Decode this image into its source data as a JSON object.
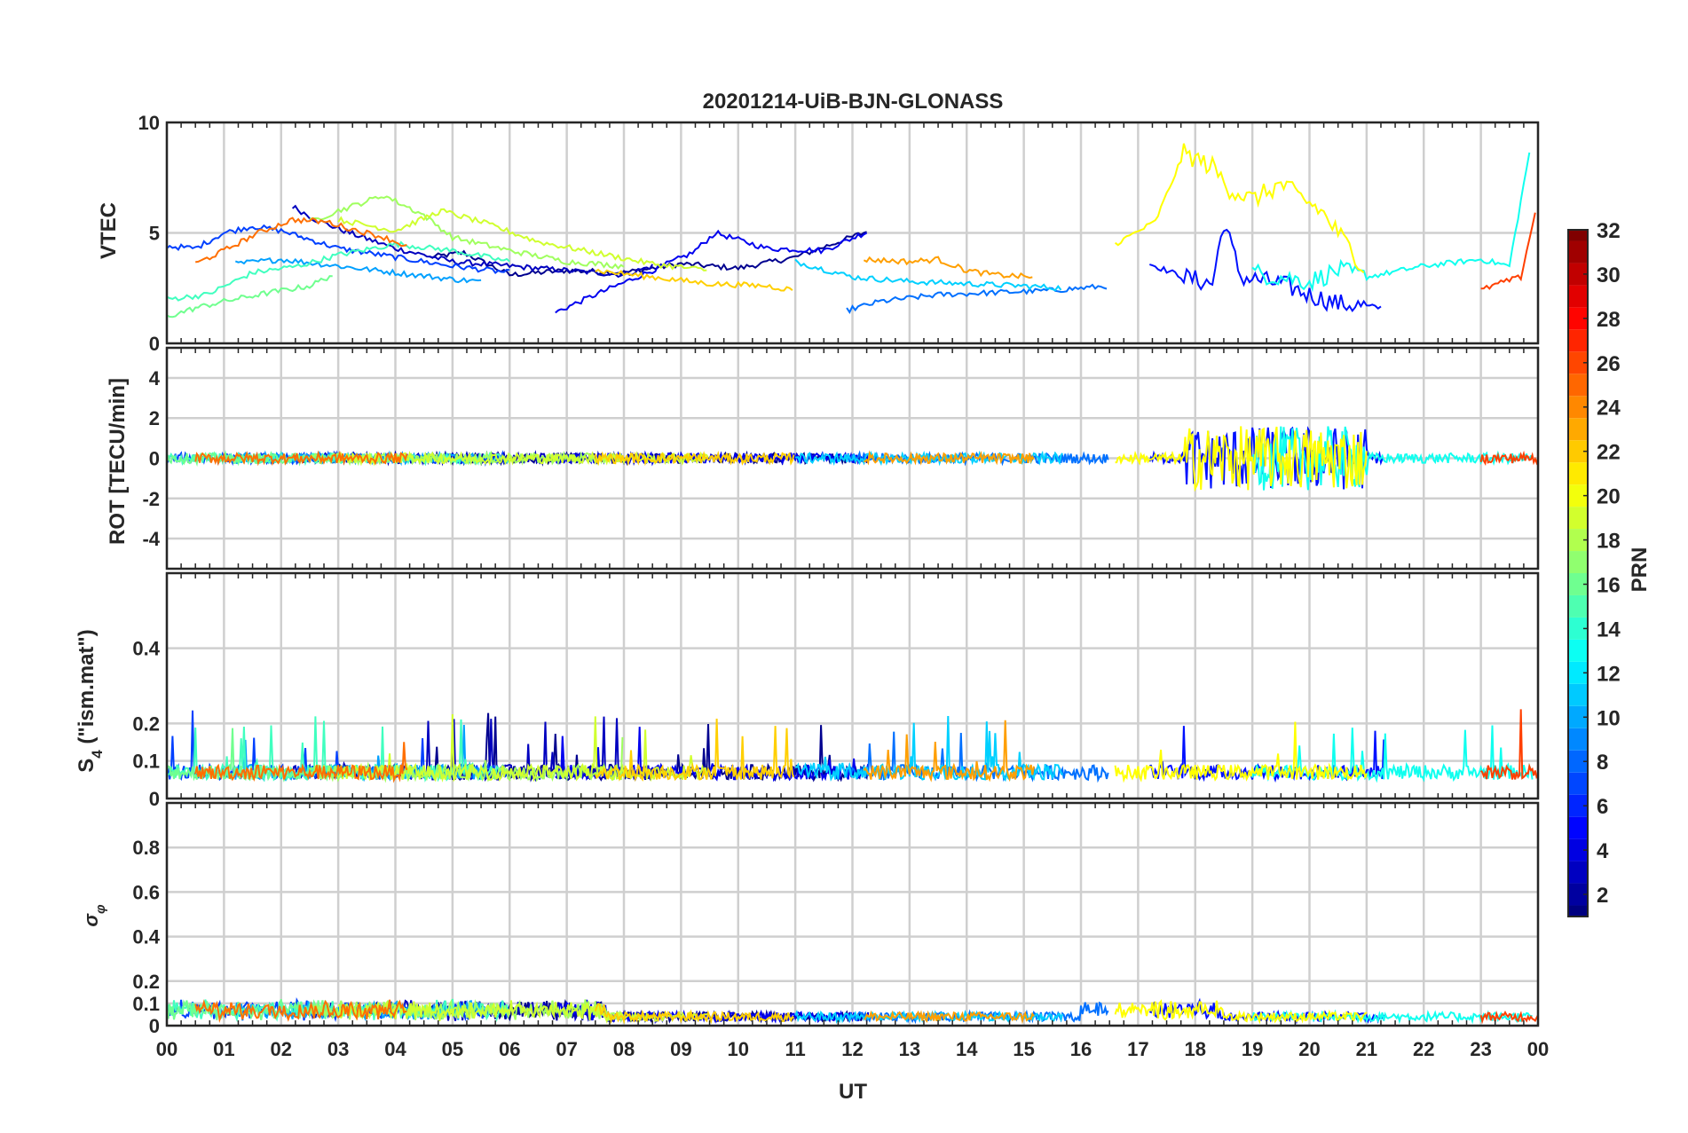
{
  "chart_data": {
    "type": "line",
    "title": "20201214-UiB-BJN-GLONASS",
    "xlabel": "UT",
    "x_tick_labels": [
      "00",
      "01",
      "02",
      "03",
      "04",
      "05",
      "06",
      "07",
      "08",
      "09",
      "10",
      "11",
      "12",
      "13",
      "14",
      "15",
      "16",
      "17",
      "18",
      "19",
      "20",
      "21",
      "22",
      "23",
      "00"
    ],
    "x_range_hours": [
      0,
      24
    ],
    "grid": true,
    "panels": [
      {
        "id": "vtec",
        "ylabel": "VTEC",
        "ylim": [
          0,
          10
        ],
        "y_ticks": [
          0,
          5,
          10
        ],
        "y_tick_labels": [
          "0",
          "5",
          "10"
        ]
      },
      {
        "id": "rot",
        "ylabel": "ROT [TECU/min]",
        "ylim": [
          -5.5,
          5.5
        ],
        "y_ticks": [
          -4,
          -2,
          0,
          2,
          4
        ],
        "y_tick_labels": [
          "-4",
          "-2",
          "0",
          "2",
          "4"
        ]
      },
      {
        "id": "s4",
        "ylabel_main": "S",
        "ylabel_sub": "4",
        "ylabel_rest": " (\"ism.mat\")",
        "ylim": [
          0,
          0.6
        ],
        "y_ticks": [
          0,
          0.1,
          0.2,
          0.4
        ],
        "y_tick_labels": [
          "0",
          "0.1",
          "0.2",
          "0.4"
        ]
      },
      {
        "id": "sigma",
        "ylabel_main": "σ",
        "ylabel_sub": "φ",
        "ylim": [
          0,
          1
        ],
        "y_ticks": [
          0,
          0.1,
          0.2,
          0.4,
          0.6,
          0.8
        ],
        "y_tick_labels": [
          "0",
          "0.1",
          "0.2",
          "0.4",
          "0.6",
          "0.8"
        ]
      }
    ],
    "colorbar": {
      "label": "PRN",
      "range": [
        1,
        32
      ],
      "colormap": "jet",
      "ticks": [
        2,
        4,
        6,
        8,
        10,
        12,
        14,
        16,
        18,
        20,
        22,
        24,
        26,
        28,
        30,
        32
      ],
      "tick_labels": [
        "2",
        "4",
        "6",
        "8",
        "10",
        "12",
        "14",
        "16",
        "18",
        "20",
        "22",
        "24",
        "26",
        "28",
        "30",
        "32"
      ]
    },
    "series": [
      {
        "prn": 1,
        "color": "#00008f",
        "vtec": [
          [
            4.6,
            3.9
          ],
          [
            5.2,
            4.1
          ],
          [
            6.0,
            3.1
          ],
          [
            7.0,
            3.3
          ],
          [
            8.0,
            3.2
          ],
          [
            9.0,
            3.6
          ],
          [
            10.0,
            3.4
          ],
          [
            11.0,
            3.9
          ],
          [
            12.3,
            5.1
          ]
        ]
      },
      {
        "prn": 2,
        "color": "#0000bf",
        "vtec": [
          [
            2.2,
            6.2
          ],
          [
            2.6,
            5.6
          ],
          [
            3.2,
            5.0
          ],
          [
            4.0,
            4.3
          ],
          [
            5.0,
            3.7
          ],
          [
            6.0,
            3.5
          ],
          [
            7.0,
            3.3
          ],
          [
            8.0,
            3.1
          ],
          [
            8.5,
            3.5
          ]
        ]
      },
      {
        "prn": 3,
        "color": "#0000ef",
        "vtec": [
          [
            6.8,
            1.4
          ],
          [
            7.5,
            2.2
          ],
          [
            8.5,
            3.3
          ],
          [
            9.2,
            4.1
          ],
          [
            9.6,
            5.0
          ],
          [
            10.5,
            4.3
          ],
          [
            11.5,
            4.2
          ],
          [
            12.3,
            5.1
          ]
        ]
      },
      {
        "prn": 4,
        "color": "#0010ff",
        "vtec": [
          [
            17.2,
            3.6
          ],
          [
            17.8,
            3.0
          ],
          [
            18.3,
            2.7
          ],
          [
            18.5,
            5.5
          ],
          [
            18.8,
            3.0
          ],
          [
            19.5,
            2.7
          ],
          [
            20.0,
            2.2
          ],
          [
            20.5,
            1.8
          ],
          [
            21.3,
            1.6
          ]
        ]
      },
      {
        "prn": 5,
        "color": "#0040ff",
        "vtec": [
          [
            0.0,
            4.4
          ],
          [
            0.5,
            4.3
          ],
          [
            1.0,
            5.0
          ],
          [
            1.5,
            5.3
          ],
          [
            2.0,
            5.1
          ],
          [
            3.0,
            4.3
          ],
          [
            4.0,
            3.9
          ],
          [
            5.0,
            3.5
          ],
          [
            6.0,
            3.2
          ]
        ]
      },
      {
        "prn": 6,
        "color": "#0070ff",
        "vtec": [
          [
            11.9,
            1.5
          ],
          [
            12.5,
            1.9
          ],
          [
            13.5,
            2.2
          ],
          [
            14.5,
            2.3
          ],
          [
            15.5,
            2.4
          ],
          [
            16.5,
            2.6
          ]
        ]
      },
      {
        "prn": 7,
        "color": "#00a0ff",
        "vtec": [
          [
            1.2,
            3.6
          ],
          [
            2.0,
            3.8
          ],
          [
            3.0,
            3.5
          ],
          [
            4.0,
            3.2
          ],
          [
            5.0,
            2.9
          ],
          [
            5.5,
            2.8
          ]
        ]
      },
      {
        "prn": 8,
        "color": "#00d0ff",
        "vtec": [
          [
            11.0,
            3.7
          ],
          [
            12.0,
            3.0
          ],
          [
            13.0,
            2.8
          ],
          [
            14.0,
            2.7
          ],
          [
            15.0,
            2.6
          ],
          [
            15.7,
            2.5
          ]
        ]
      },
      {
        "prn": 9,
        "color": "#10ffef",
        "vtec": [
          [
            19.0,
            3.2
          ],
          [
            20.0,
            2.8
          ],
          [
            20.5,
            3.3
          ],
          [
            21.0,
            3.0
          ],
          [
            22.0,
            3.5
          ],
          [
            23.0,
            3.8
          ],
          [
            23.5,
            3.5
          ],
          [
            23.9,
            9.4
          ]
        ]
      },
      {
        "prn": 10,
        "color": "#40ffbf",
        "vtec": [
          [
            0.0,
            2.0
          ],
          [
            0.7,
            2.2
          ],
          [
            1.5,
            3.2
          ],
          [
            2.3,
            3.5
          ],
          [
            3.0,
            4.0
          ],
          [
            4.0,
            4.5
          ],
          [
            5.0,
            4.2
          ],
          [
            6.0,
            3.7
          ]
        ]
      },
      {
        "prn": 11,
        "color": "#70ff8f",
        "vtec": [
          [
            0.0,
            1.2
          ],
          [
            0.5,
            1.6
          ],
          [
            1.0,
            1.9
          ],
          [
            1.8,
            2.3
          ],
          [
            2.5,
            2.6
          ],
          [
            2.9,
            3.1
          ]
        ]
      },
      {
        "prn": 12,
        "color": "#a0ff5f",
        "vtec": [
          [
            2.5,
            5.5
          ],
          [
            3.0,
            6.0
          ],
          [
            3.8,
            6.7
          ],
          [
            4.5,
            5.8
          ],
          [
            5.0,
            4.8
          ],
          [
            6.0,
            4.2
          ],
          [
            7.0,
            3.7
          ],
          [
            8.0,
            3.5
          ]
        ]
      },
      {
        "prn": 13,
        "color": "#d0ff2f",
        "vtec": [
          [
            3.0,
            5.6
          ],
          [
            4.0,
            5.1
          ],
          [
            4.8,
            6.0
          ],
          [
            5.5,
            5.5
          ],
          [
            6.5,
            4.6
          ],
          [
            7.5,
            4.1
          ],
          [
            8.5,
            3.6
          ],
          [
            9.5,
            3.3
          ]
        ]
      },
      {
        "prn": 14,
        "color": "#ffff00",
        "vtec": [
          [
            16.6,
            4.5
          ],
          [
            17.3,
            5.5
          ],
          [
            17.8,
            8.6
          ],
          [
            18.3,
            8.0
          ],
          [
            18.6,
            7.0
          ],
          [
            19.0,
            6.5
          ],
          [
            19.5,
            7.2
          ],
          [
            20.2,
            6.0
          ],
          [
            20.8,
            4.0
          ],
          [
            21.0,
            3.2
          ]
        ]
      },
      {
        "prn": 15,
        "color": "#ffcf00",
        "vtec": [
          [
            7.5,
            3.3
          ],
          [
            8.5,
            3.0
          ],
          [
            9.5,
            2.7
          ],
          [
            10.5,
            2.6
          ],
          [
            11.0,
            2.4
          ]
        ]
      },
      {
        "prn": 16,
        "color": "#ff9f00",
        "vtec": [
          [
            12.2,
            3.8
          ],
          [
            13.0,
            3.7
          ],
          [
            13.5,
            3.8
          ],
          [
            14.0,
            3.3
          ],
          [
            14.5,
            3.1
          ],
          [
            15.2,
            3.0
          ]
        ]
      },
      {
        "prn": 17,
        "color": "#ff6f00",
        "vtec": [
          [
            0.5,
            3.6
          ],
          [
            1.0,
            4.2
          ],
          [
            1.6,
            5.0
          ],
          [
            2.2,
            5.6
          ],
          [
            2.8,
            5.5
          ],
          [
            3.2,
            5.2
          ],
          [
            3.8,
            4.8
          ],
          [
            4.2,
            4.4
          ]
        ]
      },
      {
        "prn": 18,
        "color": "#ff3f00",
        "vtec": [
          [
            23.0,
            2.4
          ],
          [
            23.3,
            2.7
          ],
          [
            23.7,
            3.0
          ],
          [
            24.0,
            6.5
          ]
        ]
      }
    ]
  }
}
